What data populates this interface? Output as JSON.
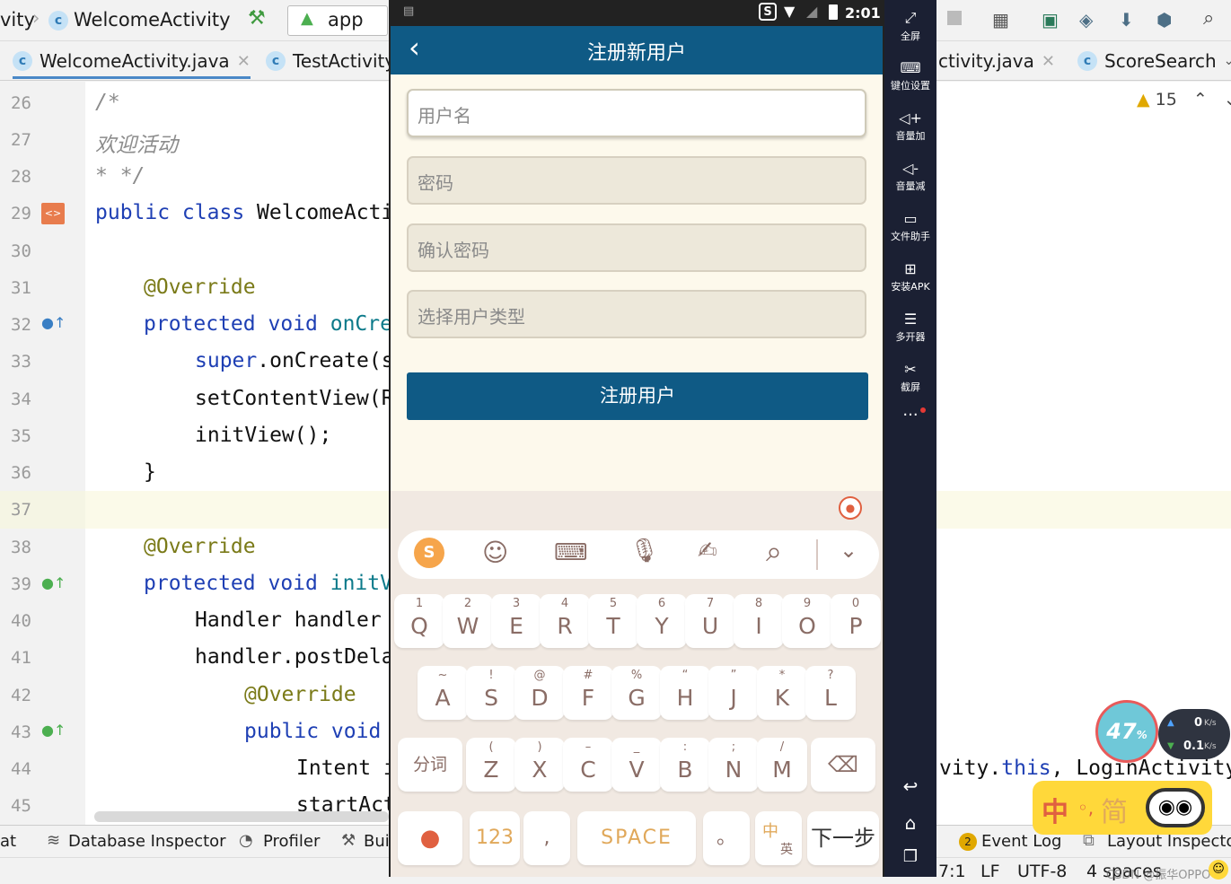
{
  "nav": {
    "crumb_prefix": "vity",
    "crumb_current": "WelcomeActivity",
    "run_config": "app"
  },
  "tabs": [
    {
      "label": "WelcomeActivity.java"
    },
    {
      "label": "TestActivity"
    },
    {
      "label": "ctivity.java"
    },
    {
      "label": "ScoreSearch"
    }
  ],
  "editor": {
    "warning_count": "15",
    "lines": [
      {
        "num": "26",
        "code": "/*"
      },
      {
        "num": "27",
        "code": "欢迎活动"
      },
      {
        "num": "28",
        "code": "* */"
      },
      {
        "num": "29",
        "code_kw": "public class",
        "code_rest": " WelcomeActi"
      },
      {
        "num": "30",
        "code": ""
      },
      {
        "num": "31",
        "code": "@Override"
      },
      {
        "num": "32",
        "code_kw": "protected void",
        "code_rest": " onCre"
      },
      {
        "num": "33",
        "code_kw": "super",
        "code_rest": ".onCreate(s"
      },
      {
        "num": "34",
        "code": "setContentView(R"
      },
      {
        "num": "35",
        "code": "initView();"
      },
      {
        "num": "36",
        "code": "}"
      },
      {
        "num": "37",
        "code": ""
      },
      {
        "num": "38",
        "code": "@Override"
      },
      {
        "num": "39",
        "code_kw": "protected void",
        "code_rest": " initV"
      },
      {
        "num": "40",
        "code": "Handler handler"
      },
      {
        "num": "41",
        "code": "handler.postDela"
      },
      {
        "num": "42",
        "code": "@Override"
      },
      {
        "num": "43",
        "code_kw": "public void",
        "code_rest": ""
      },
      {
        "num": "44",
        "code": "Intent i"
      },
      {
        "num": "45",
        "code": "startAct"
      }
    ],
    "right_code_44_a": "vity.",
    "right_code_44_kw": "this",
    "right_code_44_b": ", LoginActivity"
  },
  "bottom_tools": {
    "cut": "at",
    "database": "Database Inspector",
    "profiler": "Profiler",
    "build": "Bui",
    "event_log_count": "2",
    "event_log": "Event Log",
    "layout_inspector": "Layout Inspector"
  },
  "status": {
    "pos": "7:1",
    "lf": "LF",
    "enc": "UTF-8",
    "indent": "4 spaces"
  },
  "phone": {
    "status_time": "2:01",
    "title": "注册新用户",
    "fields": [
      {
        "placeholder": "用户名"
      },
      {
        "placeholder": "密码"
      },
      {
        "placeholder": "确认密码"
      },
      {
        "placeholder": "选择用户类型"
      }
    ],
    "register_button": "注册用户"
  },
  "keyboard": {
    "row1": [
      {
        "n": "1",
        "l": "Q"
      },
      {
        "n": "2",
        "l": "W"
      },
      {
        "n": "3",
        "l": "E"
      },
      {
        "n": "4",
        "l": "R"
      },
      {
        "n": "5",
        "l": "T"
      },
      {
        "n": "6",
        "l": "Y"
      },
      {
        "n": "7",
        "l": "U"
      },
      {
        "n": "8",
        "l": "I"
      },
      {
        "n": "9",
        "l": "O"
      },
      {
        "n": "0",
        "l": "P"
      }
    ],
    "row2": [
      {
        "n": "~",
        "l": "A"
      },
      {
        "n": "!",
        "l": "S"
      },
      {
        "n": "@",
        "l": "D"
      },
      {
        "n": "#",
        "l": "F"
      },
      {
        "n": "%",
        "l": "G"
      },
      {
        "n": "“",
        "l": "H"
      },
      {
        "n": "”",
        "l": "J"
      },
      {
        "n": "*",
        "l": "K"
      },
      {
        "n": "?",
        "l": "L"
      }
    ],
    "row3": [
      {
        "n": "(",
        "l": "Z"
      },
      {
        "n": ")",
        "l": "X"
      },
      {
        "n": "–",
        "l": "C"
      },
      {
        "n": "_",
        "l": "V"
      },
      {
        "n": ":",
        "l": "B"
      },
      {
        "n": ";",
        "l": "N"
      },
      {
        "n": "/",
        "l": "M"
      }
    ],
    "segment": "分词",
    "num_key": "123",
    "comma": ",",
    "space": "SPACE",
    "period": "。",
    "lang_top": "中",
    "lang_bottom": "英",
    "next": "下一步"
  },
  "side_toolbar": [
    {
      "label": "全屏",
      "icon": "fullscreen-icon"
    },
    {
      "label": "键位设置",
      "icon": "keyboard-icon"
    },
    {
      "label": "音量加",
      "icon": "volume-up-icon"
    },
    {
      "label": "音量减",
      "icon": "volume-down-icon"
    },
    {
      "label": "文件助手",
      "icon": "file-icon"
    },
    {
      "label": "安装APK",
      "icon": "apk-icon"
    },
    {
      "label": "多开器",
      "icon": "multi-icon"
    },
    {
      "label": "截屏",
      "icon": "scissors-icon"
    }
  ],
  "speed": {
    "percent": "47",
    "unit": "%",
    "up": "0",
    "up_unit": "K/s",
    "down": "0.1",
    "down_unit": "K/s"
  },
  "ime": {
    "zh": "中",
    "dot": "◦,",
    "jian": "简"
  },
  "watermark": "CSDN @振华OPPO"
}
